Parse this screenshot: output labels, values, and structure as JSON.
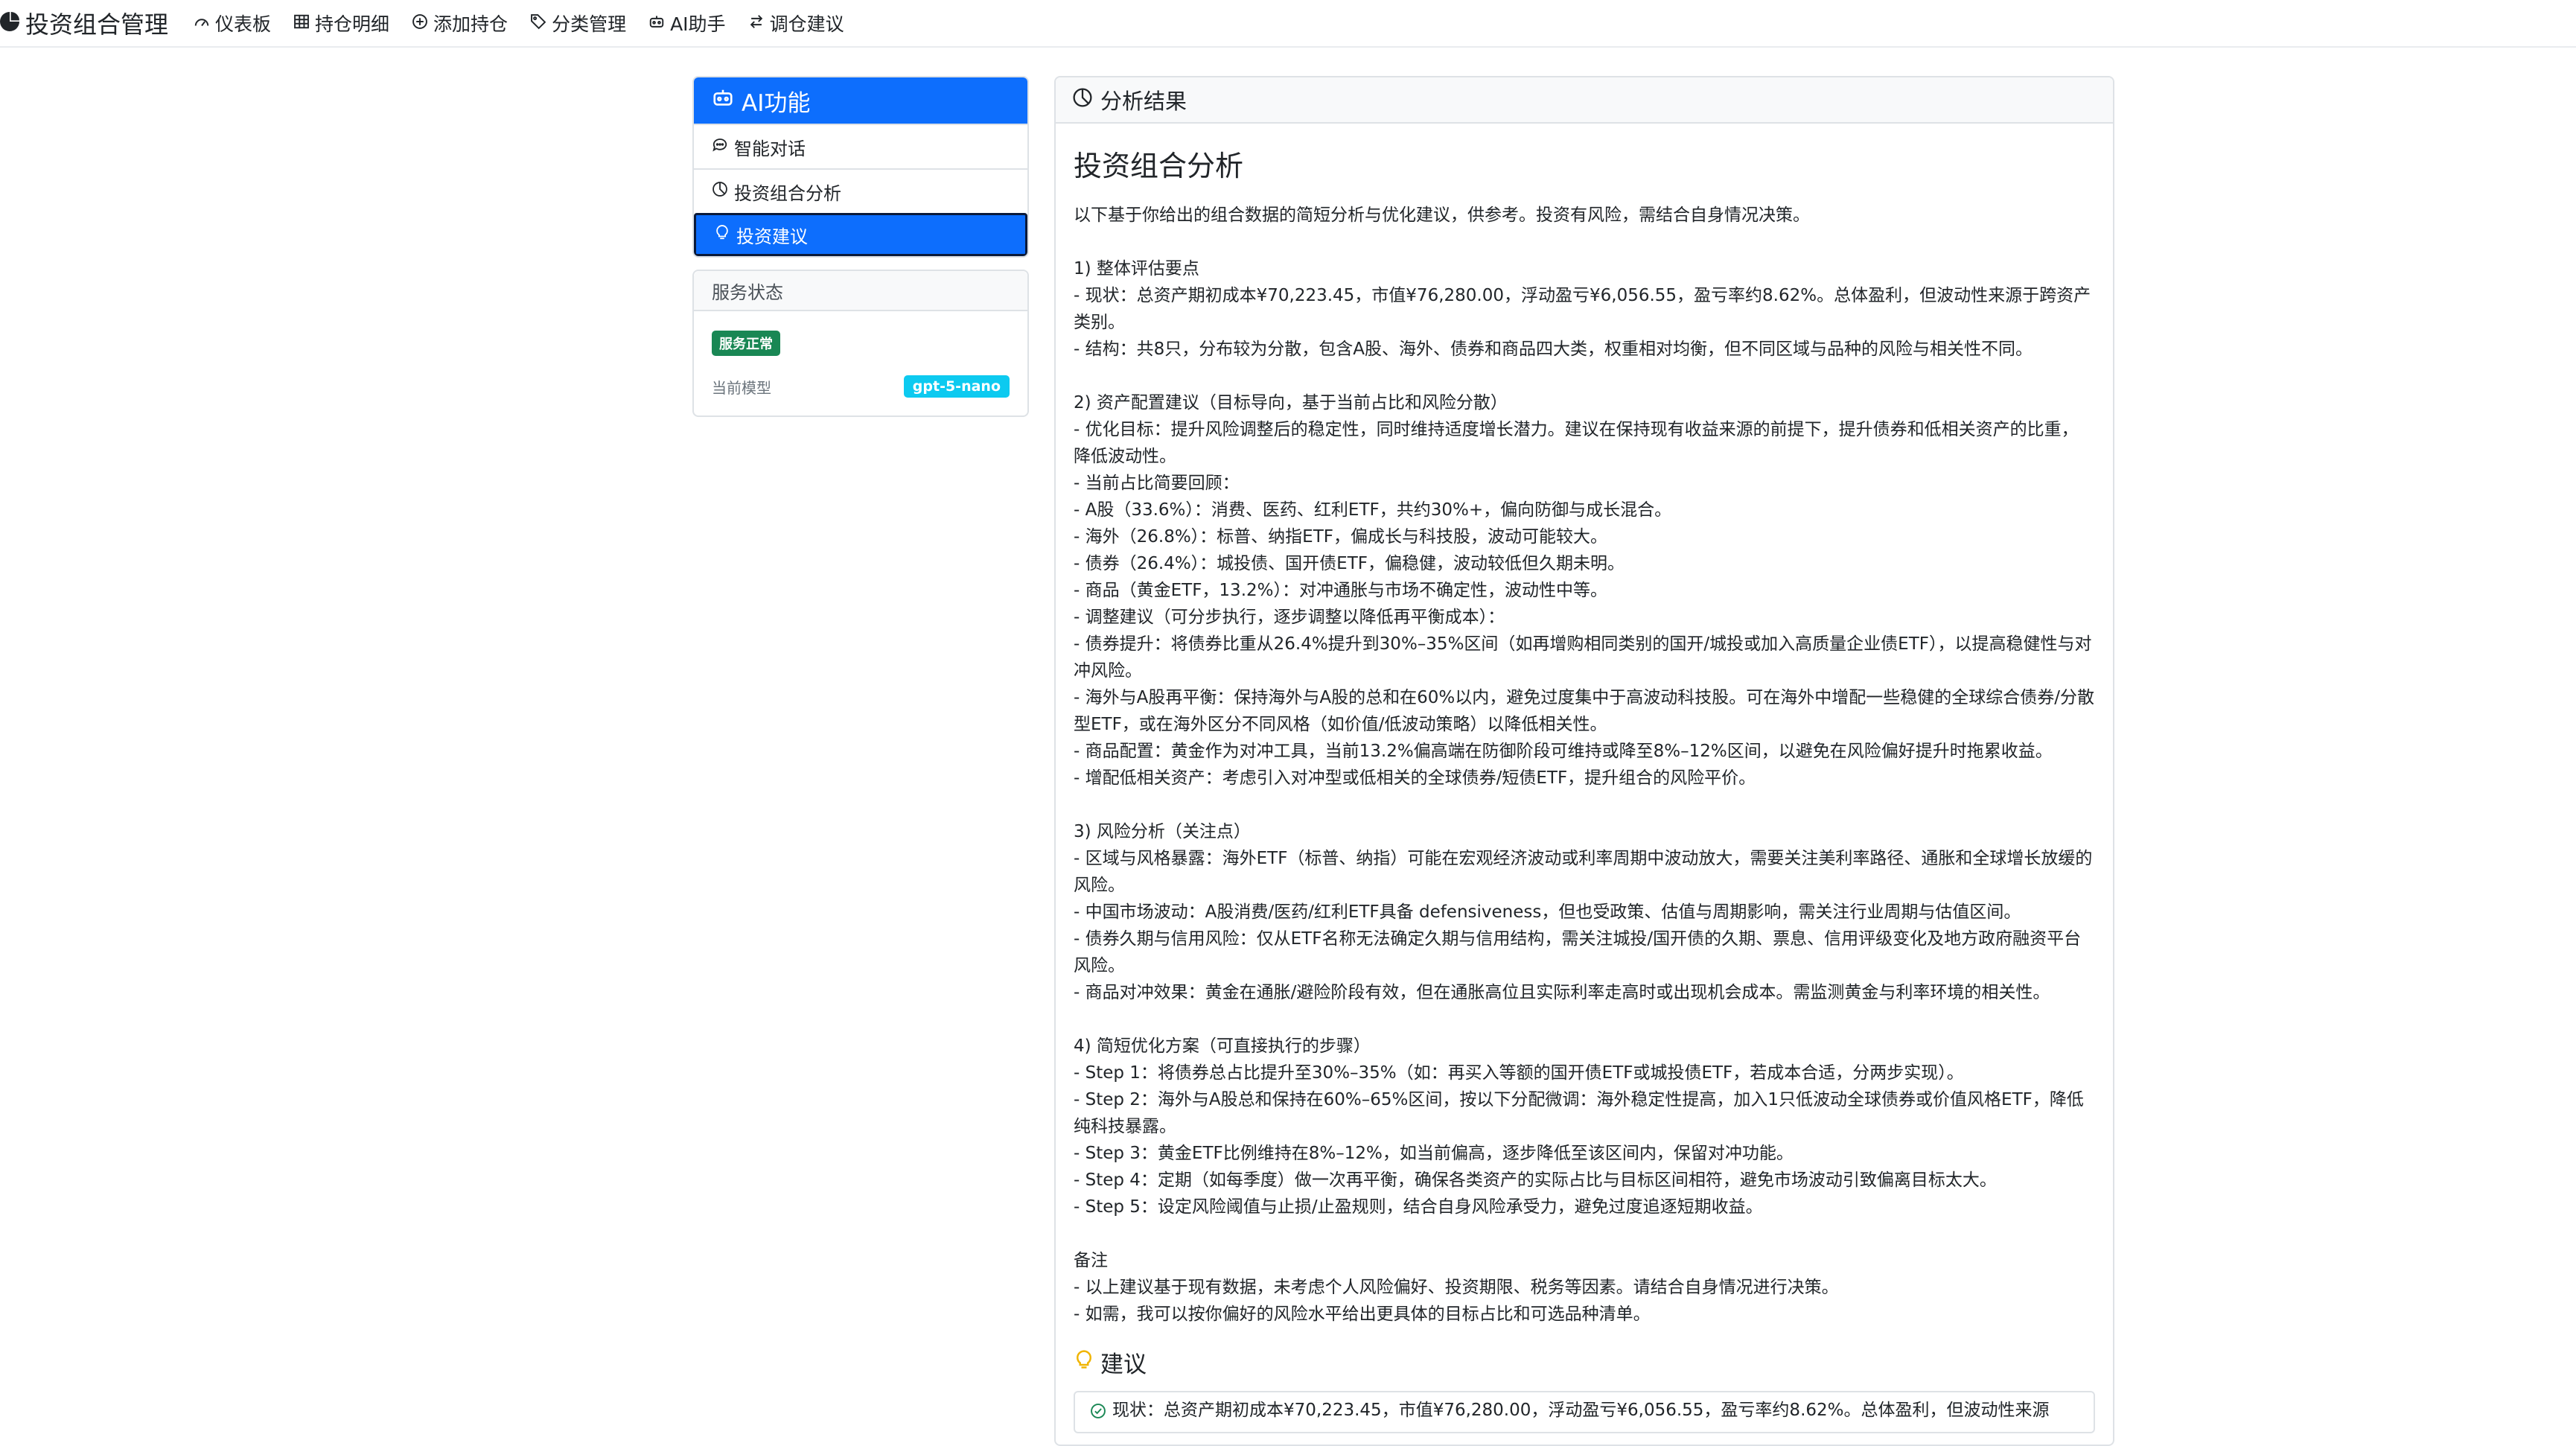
{
  "navbar": {
    "brand": "投资组合管理",
    "items": [
      {
        "label": "仪表板",
        "icon": "speedometer-icon"
      },
      {
        "label": "持仓明细",
        "icon": "table-icon"
      },
      {
        "label": "添加持仓",
        "icon": "plus-circle-icon"
      },
      {
        "label": "分类管理",
        "icon": "tag-icon"
      },
      {
        "label": "AI助手",
        "icon": "robot-icon"
      },
      {
        "label": "调仓建议",
        "icon": "arrow-left-right-icon"
      }
    ]
  },
  "sidebar": {
    "title": "AI功能",
    "items": [
      {
        "label": "智能对话",
        "icon": "chat-icon",
        "active": false
      },
      {
        "label": "投资组合分析",
        "icon": "pie-chart-icon",
        "active": false
      },
      {
        "label": "投资建议",
        "icon": "lightbulb-icon",
        "active": true
      }
    ]
  },
  "service": {
    "title": "服务状态",
    "status": "服务正常",
    "model_label": "当前模型",
    "model": "gpt-5-nano"
  },
  "result": {
    "header": "分析结果",
    "title": "投资组合分析",
    "text": "以下基于你给出的组合数据的简短分析与优化建议，供参考。投资有风险，需结合自身情况决策。\n\n1) 整体评估要点\n- 现状：总资产期初成本¥70,223.45，市值¥76,280.00，浮动盈亏¥6,056.55，盈亏率约8.62%。总体盈利，但波动性来源于跨资产类别。\n- 结构：共8只，分布较为分散，包含A股、海外、债券和商品四大类，权重相对均衡，但不同区域与品种的风险与相关性不同。\n\n2) 资产配置建议（目标导向，基于当前占比和风险分散）\n- 优化目标：提升风险调整后的稳定性，同时维持适度增长潜力。建议在保持现有收益来源的前提下，提升债券和低相关资产的比重，降低波动性。\n- 当前占比简要回顾：\n- A股（33.6%）：消费、医药、红利ETF，共约30%+，偏向防御与成长混合。\n- 海外（26.8%）：标普、纳指ETF，偏成长与科技股，波动可能较大。\n- 债券（26.4%）：城投债、国开债ETF，偏稳健，波动较低但久期未明。\n- 商品（黄金ETF，13.2%）：对冲通胀与市场不确定性，波动性中等。\n- 调整建议（可分步执行，逐步调整以降低再平衡成本）：\n- 债券提升：将债券比重从26.4%提升到30%–35%区间（如再增购相同类别的国开/城投或加入高质量企业债ETF），以提高稳健性与对冲风险。\n- 海外与A股再平衡：保持海外与A股的总和在60%以内，避免过度集中于高波动科技股。可在海外中增配一些稳健的全球综合债券/分散型ETF，或在海外区分不同风格（如价值/低波动策略）以降低相关性。\n- 商品配置：黄金作为对冲工具，当前13.2%偏高端在防御阶段可维持或降至8%–12%区间，以避免在风险偏好提升时拖累收益。\n- 增配低相关资产：考虑引入对冲型或低相关的全球债券/短债ETF，提升组合的风险平价。\n\n3) 风险分析（关注点）\n- 区域与风格暴露：海外ETF（标普、纳指）可能在宏观经济波动或利率周期中波动放大，需要关注美利率路径、通胀和全球增长放缓的风险。\n- 中国市场波动：A股消费/医药/红利ETF具备 defensiveness，但也受政策、估值与周期影响，需关注行业周期与估值区间。\n- 债券久期与信用风险：仅从ETF名称无法确定久期与信用结构，需关注城投/国开债的久期、票息、信用评级变化及地方政府融资平台风险。\n- 商品对冲效果：黄金在通胀/避险阶段有效，但在通胀高位且实际利率走高时或出现机会成本。需监测黄金与利率环境的相关性。\n\n4) 简短优化方案（可直接执行的步骤）\n- Step 1：将债券总占比提升至30%–35%（如：再买入等额的国开债ETF或城投债ETF，若成本合适，分两步实现）。\n- Step 2：海外与A股总和保持在60%–65%区间，按以下分配微调：海外稳定性提高，加入1只低波动全球债券或价值风格ETF，降低纯科技暴露。\n- Step 3：黄金ETF比例维持在8%–12%，如当前偏高，逐步降低至该区间内，保留对冲功能。\n- Step 4：定期（如每季度）做一次再平衡，确保各类资产的实际占比与目标区间相符，避免市场波动引致偏离目标太大。\n- Step 5：设定风险阈值与止损/止盈规则，结合自身风险承受力，避免过度追逐短期收益。\n\n备注\n- 以上建议基于现有数据，未考虑个人风险偏好、投资期限、税务等因素。请结合自身情况进行决策。\n- 如需，我可以按你偏好的风险水平给出更具体的目标占比和可选品种清单。",
    "suggestion_title": "建议",
    "suggestion_item": "现状：总资产期初成本¥70,223.45，市值¥76,280.00，浮动盈亏¥6,056.55，盈亏率约8.62%。总体盈利，但波动性来源"
  }
}
